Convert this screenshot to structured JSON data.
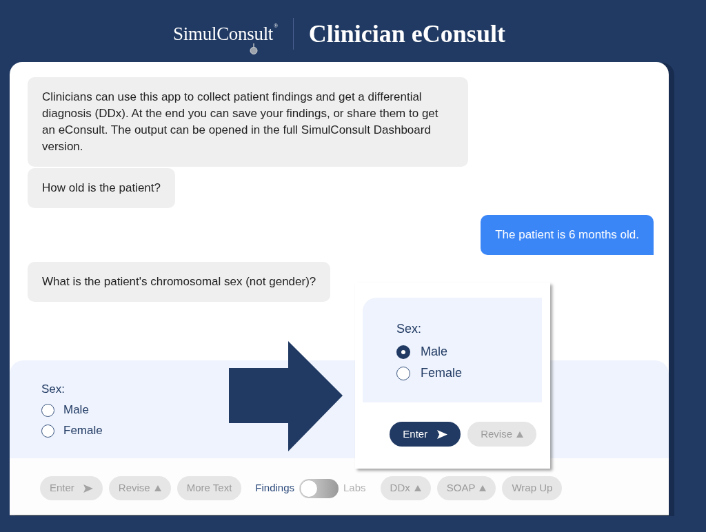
{
  "header": {
    "logo": "SimulConsult$^{®}$",
    "title": "Clinician eConsult"
  },
  "messages": [
    {
      "kind": "bot",
      "text": "Clinicians can use this app to collect patient findings and get a differential diagnosis (DDx). At the end you can save your findings, or share them to get an eConsult. The output can be opened in the full SimulConsult Dashboard version."
    },
    {
      "kind": "bot",
      "text": "How old is the patient?"
    },
    {
      "kind": "user",
      "text": "The patient is 6 months old."
    },
    {
      "kind": "bot",
      "text": "What is the patient's chromosomal sex (not gender)?"
    }
  ],
  "answer_panel": {
    "label": "Sex:",
    "options": [
      {
        "label": "Male",
        "selected": false
      },
      {
        "label": "Female",
        "selected": false
      }
    ]
  },
  "toolbar": {
    "items": [
      {
        "kind": "send",
        "label": "Enter",
        "disabled": true
      },
      {
        "kind": "menu",
        "label": "Revise",
        "disabled": true
      },
      {
        "kind": "plain",
        "label": "More Text",
        "disabled": true
      },
      {
        "kind": "toggle",
        "left_label": "Findings",
        "right_label": "Labs",
        "on": false
      },
      {
        "kind": "menu",
        "label": "DDx",
        "disabled": true
      },
      {
        "kind": "menu",
        "label": "SOAP",
        "disabled": true
      },
      {
        "kind": "plain",
        "label": "Wrap Up",
        "disabled": true
      }
    ]
  },
  "callout": {
    "label": "Sex:",
    "options": [
      {
        "label": "Male",
        "selected": true
      },
      {
        "label": "Female",
        "selected": false
      }
    ],
    "buttons": [
      {
        "kind": "send",
        "label": "Enter",
        "disabled": false
      },
      {
        "kind": "menu",
        "label": "Revise",
        "disabled": true
      }
    ]
  }
}
